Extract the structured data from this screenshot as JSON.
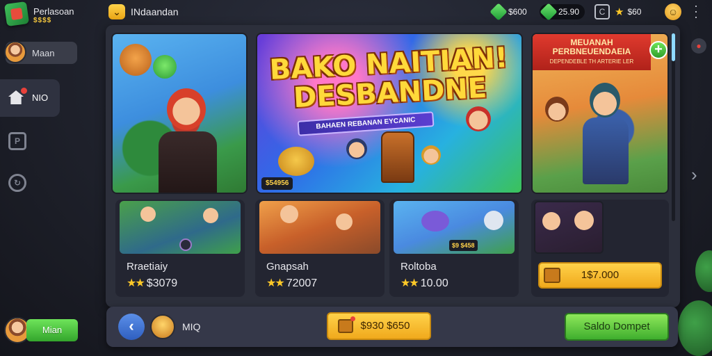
{
  "header": {
    "app_title": "Perlasoan",
    "app_sub": "$$$$",
    "nav_title": "INdaandan",
    "nav_badge_icon": "chevron-down-icon",
    "currency_a": "$600",
    "currency_b": "25.90",
    "square_btn": "C",
    "star_value": "$60",
    "avatar_icon": "smiley-icon",
    "menu_icon": "more-vertical-icon"
  },
  "sidebar": {
    "user_name": "Maan",
    "home_label": "NIO",
    "items": [
      {
        "icon": "flag-icon",
        "glyph": "P"
      },
      {
        "icon": "refresh-icon",
        "glyph": "↻"
      }
    ],
    "bottom_button": "Mian"
  },
  "featured": {
    "banner_title": "BAKO NAITIAN! DESBANDNE",
    "banner_sub": "BAHAEN REBANAN EYCANIC",
    "banner_tag": "$54956",
    "card3_title": "MEUANAH PERBNEUENDAEIA",
    "card3_sub": "DEPENDEBLE TH ARTERIE LER",
    "plus_icon": "plus-icon"
  },
  "games": [
    {
      "name": "Rraetiaiy",
      "rating": "$3079",
      "badge": ""
    },
    {
      "name": "Gnapsah",
      "rating": "72007",
      "badge": ""
    },
    {
      "name": "Roltoba",
      "rating": "10.00",
      "badge": "$9 $458"
    }
  ],
  "card4": {
    "price": "1$7.000"
  },
  "bottombar": {
    "back_icon": "chevron-left-icon",
    "label": "MIQ",
    "coin_value": "$930 $650",
    "green_button": "Saldo Dompet"
  },
  "colors": {
    "accent_yellow": "#ffd24a",
    "accent_green": "#5fd24a",
    "panel": "#2c2f3b",
    "background": "#1b1d26"
  }
}
